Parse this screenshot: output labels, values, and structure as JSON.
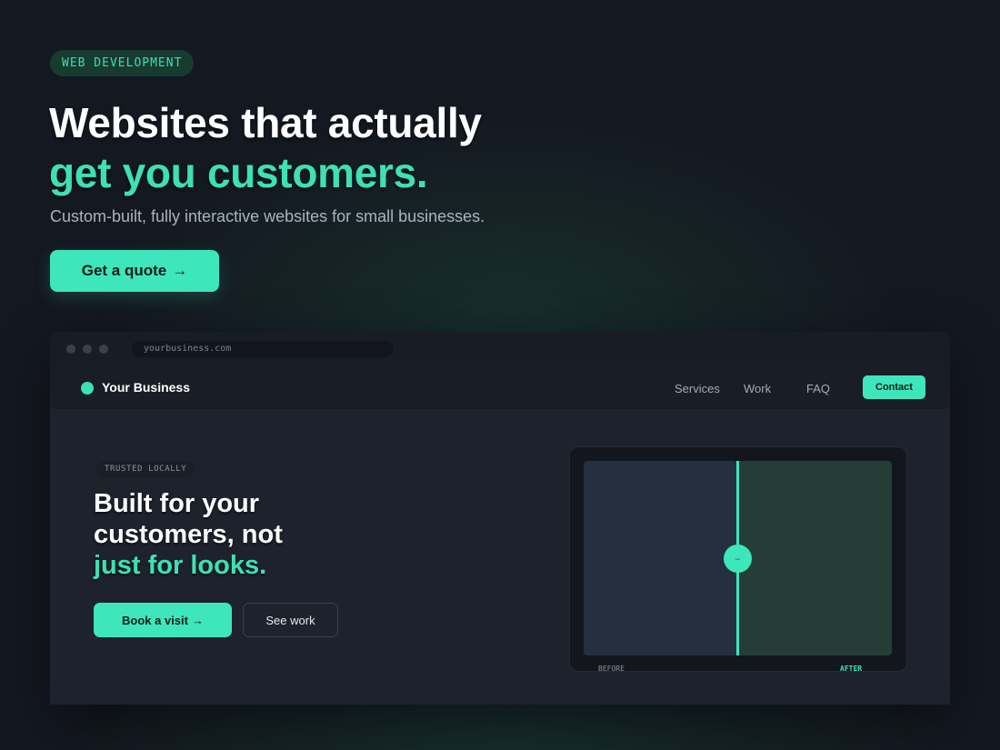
{
  "hero": {
    "tag": "WEB DEVELOPMENT",
    "title_line1": "Websites that actually",
    "title_line2": "get you customers.",
    "subtitle": "Custom-built, fully interactive websites for small businesses.",
    "cta_label": "Get a quote",
    "cta_arrow": "→"
  },
  "browser": {
    "url": "yourbusiness.com"
  },
  "site": {
    "brand": "Your Business",
    "nav": [
      "Services",
      "Work",
      "FAQ"
    ],
    "contact_label": "Contact",
    "badge": "TRUSTED LOCALLY",
    "title_line1": "Built for your",
    "title_line2": "customers, not",
    "title_line3": "just for looks.",
    "book_label": "Book a visit",
    "book_arrow": "→",
    "see_label": "See work",
    "compare": {
      "handle_glyph": "⇔",
      "before_label": "BEFORE",
      "after_label": "AFTER"
    }
  },
  "colors": {
    "accent": "#3ee6bb",
    "background": "#141820",
    "tag_bg": "#173b2e"
  }
}
